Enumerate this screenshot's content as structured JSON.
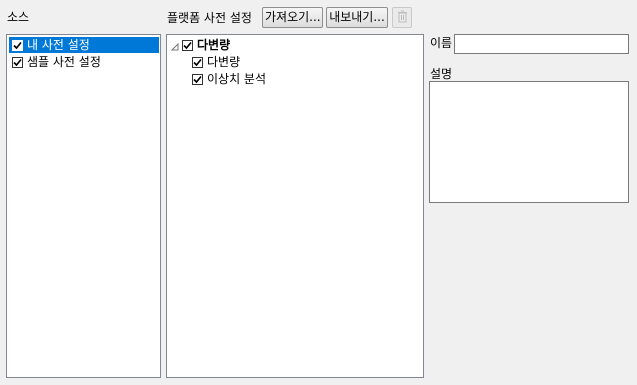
{
  "source": {
    "heading": "소스",
    "items": [
      {
        "label": "내 사전 설정",
        "checked": true,
        "selected": true
      },
      {
        "label": "샘플 사전 설정",
        "checked": true,
        "selected": false
      }
    ]
  },
  "platform": {
    "heading": "플랫폼 사전 설정",
    "import_label": "가져오기...",
    "export_label": "내보내기...",
    "delete_icon": "trash-icon",
    "tree": {
      "root": {
        "label": "다변량",
        "checked": true,
        "expanded": true
      },
      "children": [
        {
          "label": "다변량",
          "checked": true
        },
        {
          "label": "이상치 분석",
          "checked": true
        }
      ]
    }
  },
  "details": {
    "name_label": "이름",
    "name_value": "",
    "description_label": "설명",
    "description_value": ""
  },
  "colors": {
    "selection": "#0078d7",
    "background": "#f0f0f0",
    "border": "#828790"
  }
}
